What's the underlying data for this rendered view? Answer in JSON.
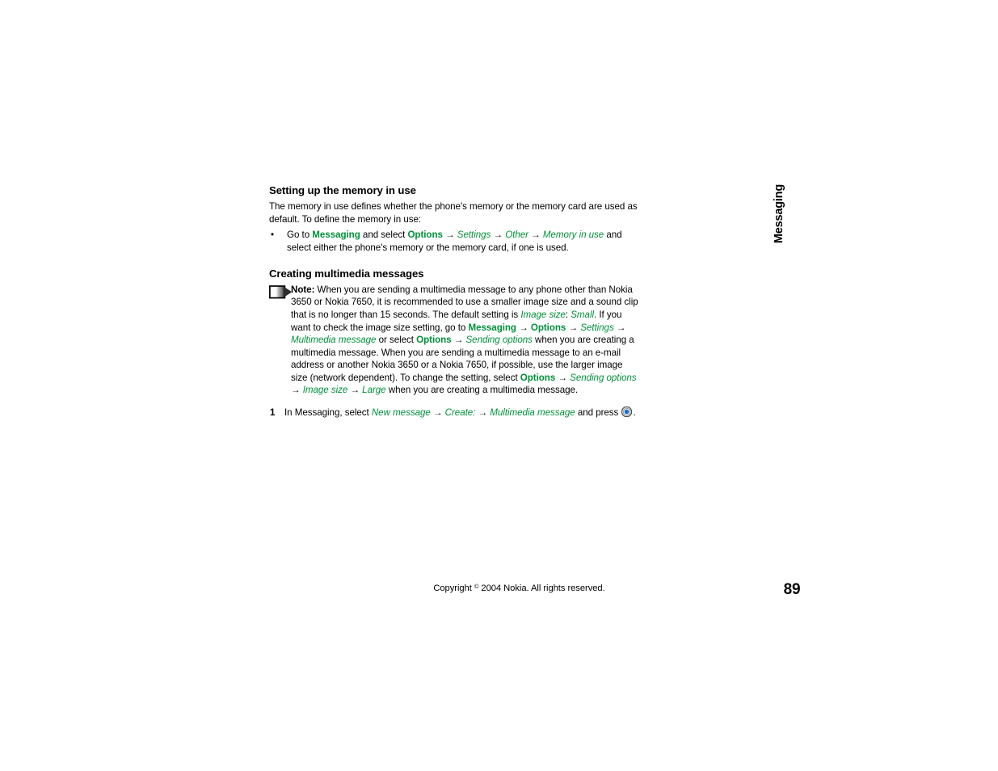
{
  "page": {
    "number": "89",
    "side_tab_label": "Messaging",
    "copyright_prefix": "Copyright ",
    "copyright_symbol": "©",
    "copyright_suffix": " 2004 Nokia. All rights reserved."
  },
  "colors": {
    "ui_term_green": "#00913a",
    "body_black": "#000000",
    "scroll_key_blue": "#1a6fd4"
  },
  "sections": [
    {
      "heading": "Setting up the memory in use",
      "paragraph": "The memory in use defines whether the phone's memory or the memory card are used as default. To define the memory in use:",
      "bullet": {
        "marker": "•",
        "parts": [
          {
            "type": "plain",
            "text": "Go to "
          },
          {
            "type": "bold",
            "text": "Messaging"
          },
          {
            "type": "plain",
            "text": " and select "
          },
          {
            "type": "bold",
            "text": "Options"
          },
          {
            "type": "arrow",
            "text": " → "
          },
          {
            "type": "italic",
            "text": "Settings"
          },
          {
            "type": "arrow",
            "text": " → "
          },
          {
            "type": "italic",
            "text": "Other"
          },
          {
            "type": "arrow",
            "text": " → "
          },
          {
            "type": "italic",
            "text": "Memory in use"
          },
          {
            "type": "plain",
            "text": " and select either the phone's memory or the memory card, if one is used."
          }
        ]
      }
    }
  ],
  "section2": {
    "heading": "Creating multimedia messages",
    "note": {
      "icon_name": "note-arrow-icon",
      "label": "Note:",
      "parts": [
        {
          "type": "plain",
          "text": " When you are sending a multimedia message to any phone other than Nokia 3650 or Nokia 7650, it is recommended to use a smaller image size and a sound clip that is no longer than 15 seconds. The default setting is "
        },
        {
          "type": "italic",
          "text": "Image size"
        },
        {
          "type": "plain",
          "text": ": "
        },
        {
          "type": "italic",
          "text": "Small"
        },
        {
          "type": "plain",
          "text": ". If you want to check the image size setting, go to "
        },
        {
          "type": "bold",
          "text": "Messaging"
        },
        {
          "type": "arrow",
          "text": " → "
        },
        {
          "type": "bold",
          "text": "Options"
        },
        {
          "type": "arrow",
          "text": " → "
        },
        {
          "type": "italic",
          "text": "Settings"
        },
        {
          "type": "arrow",
          "text": " → "
        },
        {
          "type": "italic",
          "text": "Multimedia message"
        },
        {
          "type": "plain",
          "text": " or select "
        },
        {
          "type": "bold",
          "text": "Options"
        },
        {
          "type": "arrow",
          "text": " → "
        },
        {
          "type": "italic",
          "text": "Sending options"
        },
        {
          "type": "plain",
          "text": " when you are creating a multimedia message. When you are sending a multimedia message to an e-mail address or another Nokia 3650 or a Nokia 7650, if possible, use the larger image size (network dependent). To change the setting, select "
        },
        {
          "type": "bold",
          "text": "Options"
        },
        {
          "type": "arrow",
          "text": " → "
        },
        {
          "type": "italic",
          "text": "Sending options"
        },
        {
          "type": "arrow",
          "text": " → "
        },
        {
          "type": "italic",
          "text": "Image size"
        },
        {
          "type": "arrow",
          "text": " → "
        },
        {
          "type": "italic",
          "text": "Large"
        },
        {
          "type": "plain",
          "text": " when you are creating a multimedia message."
        }
      ]
    },
    "steps": [
      {
        "number": "1",
        "parts": [
          {
            "type": "plain",
            "text": "In Messaging, select "
          },
          {
            "type": "italic",
            "text": "New message"
          },
          {
            "type": "arrow",
            "text": " → "
          },
          {
            "type": "italic",
            "text": "Create:"
          },
          {
            "type": "arrow",
            "text": " → "
          },
          {
            "type": "italic",
            "text": "Multimedia message"
          },
          {
            "type": "plain",
            "text": " and press "
          },
          {
            "type": "icon",
            "text": "scroll-key-icon"
          },
          {
            "type": "plain",
            "text": "."
          }
        ]
      }
    ]
  }
}
